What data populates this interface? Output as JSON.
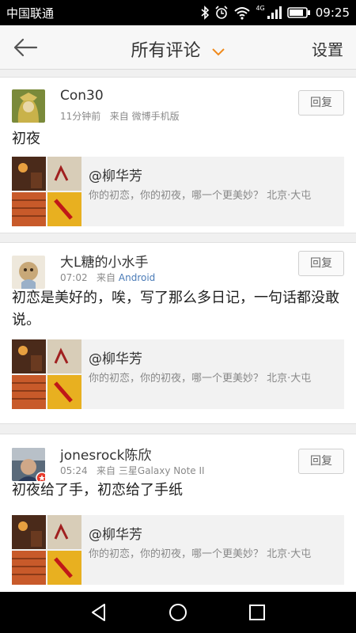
{
  "status": {
    "carrier": "中国联通",
    "net": "4G",
    "time": "09:25"
  },
  "header": {
    "title": "所有评论",
    "settings": "设置"
  },
  "comments": [
    {
      "user": "Con30",
      "time": "11分钟前",
      "source_prefix": "来自",
      "source": "微博手机版",
      "source_is_link": false,
      "reply": "回复",
      "text": "初夜",
      "quote": {
        "name": "@柳华芳",
        "text": "你的初恋，你的初夜，哪一个更美妙？ 北京·大屯"
      }
    },
    {
      "user": "大L糖的小水手",
      "time": "07:02",
      "source_prefix": "来自",
      "source": "Android",
      "source_is_link": true,
      "reply": "回复",
      "text": "初恋是美好的，唉，写了那么多日记，一句话都没敢说。",
      "quote": {
        "name": "@柳华芳",
        "text": "你的初恋，你的初夜，哪一个更美妙？ 北京·大屯"
      }
    },
    {
      "user": "jonesrock陈欣",
      "time": "05:24",
      "source_prefix": "来自",
      "source": "三星Galaxy Note II",
      "source_is_link": false,
      "reply": "回复",
      "text": "初夜给了手，初恋给了手纸",
      "quote": {
        "name": "@柳华芳",
        "text": "你的初恋，你的初夜，哪一个更美妙？ 北京·大屯"
      }
    }
  ],
  "colors": {
    "accent": "#f08a1c",
    "link": "#4a7bb7",
    "badge": "#e8392a"
  }
}
